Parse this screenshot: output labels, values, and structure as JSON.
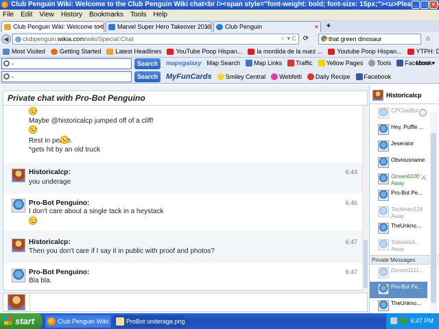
{
  "window": {
    "title": "Club Penguin Wiki: Welcome to the Club Penguin Wiki chat<br /><span style=\"font-weight: bold; font-size: 15px;\"><u>Please follow [[Club Pengui..."
  },
  "menu": [
    "File",
    "Edit",
    "View",
    "History",
    "Bookmarks",
    "Tools",
    "Help"
  ],
  "tabs": [
    {
      "label": "Club Penguin Wiki: Welcome to the Club ...",
      "active": true
    },
    {
      "label": "Marvel Super Hero Takeover 2013 - Club ...",
      "active": false
    },
    {
      "label": "Club Penguin",
      "active": false
    }
  ],
  "nav": {
    "url_domain": "clubpenguin.",
    "url_host": "wikia.com",
    "url_path": "/wiki/Special:Chat",
    "search_value": "that green dinosaur"
  },
  "bookmarks": [
    "Most Visited",
    "Getting Started",
    "Latest Headlines",
    "YouTube Poop Hispan...",
    "la mordida de la nuez ...",
    "Youtube Poop Hispan...",
    "YTPH: Don Pendejo pi..."
  ],
  "toolbar1": {
    "search_value": "-",
    "search_button": "Search",
    "items": [
      "mapsgalaxy",
      "Map Search",
      "Map Links",
      "Traffic",
      "Yellow Pages",
      "Tools",
      "Facebook"
    ],
    "more": "More"
  },
  "toolbar2": {
    "search_value": "-",
    "search_button": "Search",
    "brand": "MyFunCards",
    "items": [
      "Smiley Central",
      "Webfetti",
      "Daily Recipe",
      "Facebook"
    ]
  },
  "chat": {
    "title": "Private chat with Pro-Bot Penguino",
    "continuation": [
      "Maybe @historicalcp jumped off of a cliff!",
      "Rest in peace.",
      "*gets hit by an old truck"
    ],
    "messages": [
      {
        "user": "Historicalcp:",
        "text": "you underage",
        "time": "6:44"
      },
      {
        "user": "Pro-Bot Penguino:",
        "text": "I don't care about a single tack in a heystack",
        "time": "6:46"
      },
      {
        "user": "Historicalcp:",
        "text": "Then you don't care if I say it in public with proof and photos?",
        "time": "6:47"
      },
      {
        "user": "Pro-Bot Penguino:",
        "text": "Bla bla.",
        "time": "6:47"
      }
    ]
  },
  "userlist": {
    "self": "Historicalcp",
    "users": [
      {
        "name": "CPChatBot",
        "status": "",
        "type": "away"
      },
      {
        "name": "Hey, Puffle ...",
        "status": "",
        "type": "normal"
      },
      {
        "name": "Jeserator",
        "status": "",
        "type": "normal"
      },
      {
        "name": "Obviousname",
        "status": "",
        "type": "normal"
      },
      {
        "name": "Ocean6100",
        "status": "Away",
        "type": "green"
      },
      {
        "name": "Pro-Bot Pe...",
        "status": "",
        "type": "normal"
      },
      {
        "name": "Techman129",
        "status": "Away",
        "type": "away"
      },
      {
        "name": "TheUnkno...",
        "status": "",
        "type": "normal"
      },
      {
        "name": "TobiasIsA...",
        "status": "Away",
        "type": "away"
      }
    ],
    "pm_header": "Private Messages",
    "pms": [
      {
        "name": "Dororo1111...",
        "status": "",
        "type": "away"
      },
      {
        "name": "Pro-Bot Pe...",
        "status": "",
        "type": "sel"
      },
      {
        "name": "TheUnkno...",
        "status": "",
        "type": "normal"
      }
    ]
  },
  "taskbar": {
    "start": "start",
    "items": [
      "Club Penguin Wiki: W...",
      "ProBot underage.png..."
    ],
    "clock": "6:47 PM"
  }
}
